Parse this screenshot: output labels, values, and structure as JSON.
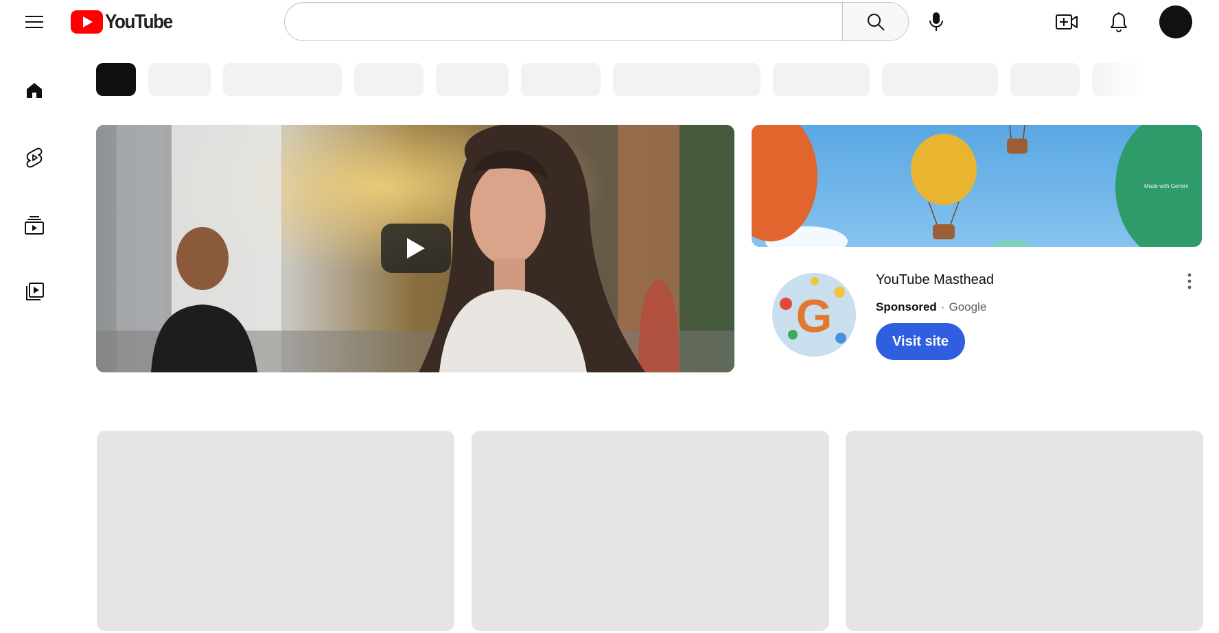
{
  "header": {
    "menu_icon": "hamburger-menu-icon",
    "logo_text": "YouTube",
    "search": {
      "value": "",
      "placeholder": ""
    },
    "icons": [
      "search-icon",
      "microphone-icon",
      "create-video-icon",
      "bell-icon"
    ]
  },
  "sidebar": {
    "items": [
      {
        "icon": "home-icon"
      },
      {
        "icon": "shorts-icon"
      },
      {
        "icon": "subscriptions-icon"
      },
      {
        "icon": "library-icon"
      }
    ]
  },
  "chips": {
    "count": 12
  },
  "player": {
    "icon": "play-icon"
  },
  "ad": {
    "banner_note": "Made with Gemini",
    "title": "YouTube Masthead",
    "sponsored": "Sponsored",
    "dot": "·",
    "advertiser": "Google",
    "cta": "Visit site",
    "logo_letter": "G",
    "more_icon": "more-vertical-icon"
  },
  "colors": {
    "youtube_red": "#ff0000",
    "cta_blue": "#2f5fe0",
    "placeholder_gray": "#e5e5e5",
    "chip_gray": "#f2f2f2"
  }
}
